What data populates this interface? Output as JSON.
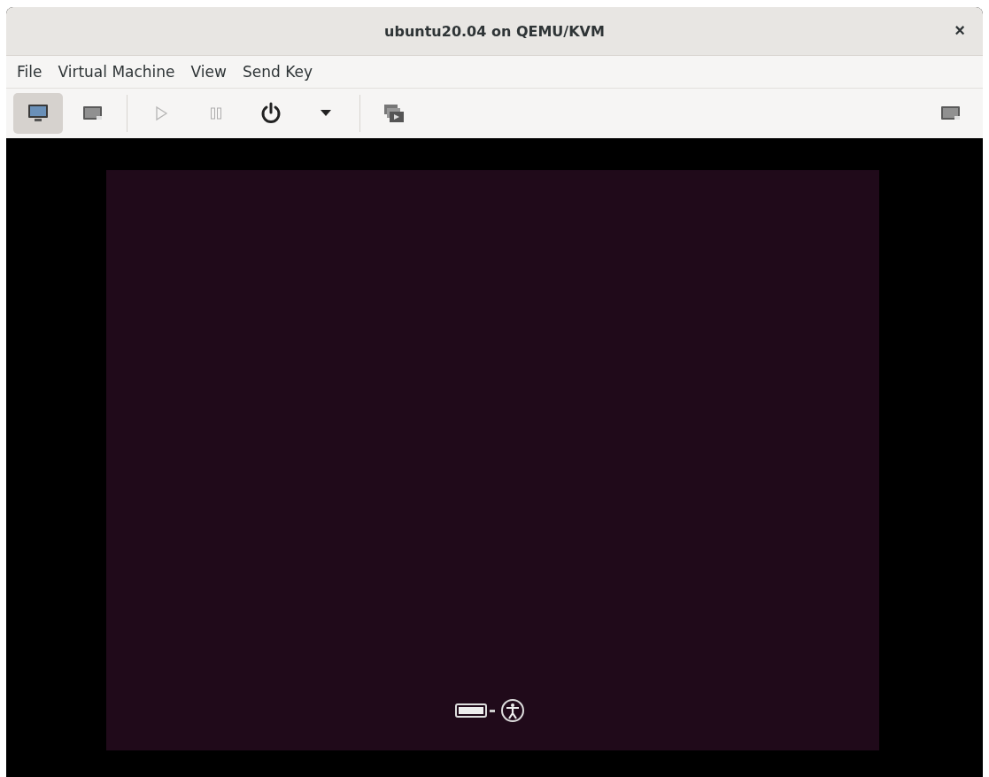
{
  "window": {
    "title": "ubuntu20.04 on QEMU/KVM",
    "close": "×"
  },
  "menu": [
    "File",
    "Virtual Machine",
    "View",
    "Send Key"
  ],
  "toolbar": [
    {
      "kind": "console",
      "selected": true,
      "disabled": false
    },
    {
      "kind": "details",
      "selected": false,
      "disabled": false
    },
    {
      "kind": "separator"
    },
    {
      "kind": "run",
      "selected": false,
      "disabled": true
    },
    {
      "kind": "pause",
      "selected": false,
      "disabled": true
    },
    {
      "kind": "power",
      "selected": false,
      "disabled": false
    },
    {
      "kind": "dropdown",
      "selected": false,
      "disabled": false
    },
    {
      "kind": "separator"
    },
    {
      "kind": "snapshots",
      "selected": false,
      "disabled": false
    },
    {
      "kind": "spacer"
    },
    {
      "kind": "fullscreen",
      "selected": false,
      "disabled": false
    }
  ]
}
